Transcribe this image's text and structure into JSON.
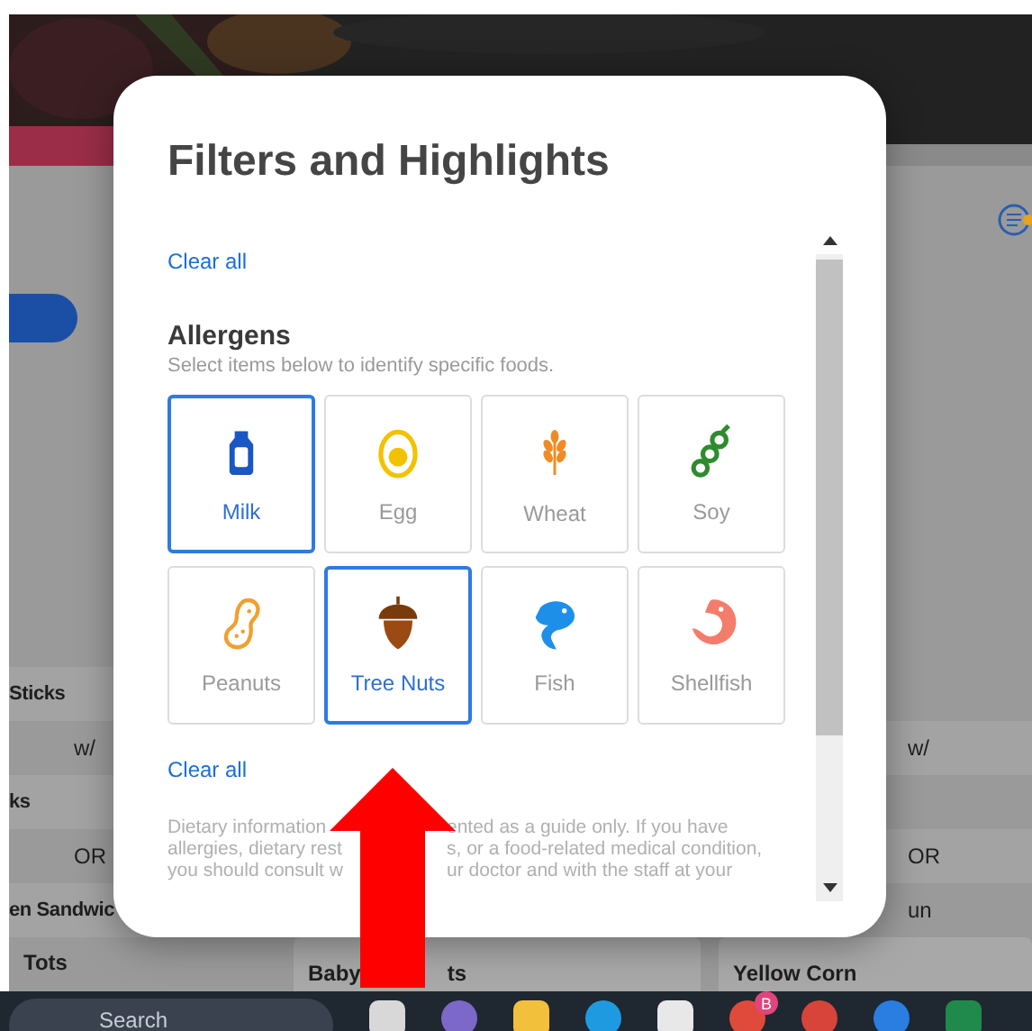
{
  "background_page": {
    "left_rows": [
      {
        "text": "Sticks",
        "kind": "name"
      },
      {
        "text": "w/",
        "kind": "joiner"
      },
      {
        "text": "ks",
        "kind": "name"
      },
      {
        "text": "OR",
        "kind": "joiner"
      },
      {
        "text": "en Sandwic",
        "kind": "name"
      }
    ],
    "right_rows": [
      {
        "text": "w/",
        "kind": "text"
      },
      {
        "kind": "blank"
      },
      {
        "text": "OR",
        "kind": "text"
      },
      {
        "text": "un",
        "kind": "text"
      }
    ],
    "bottom_cards": [
      {
        "parts": [
          "Tots"
        ]
      },
      {
        "parts": [
          "Baby",
          "ts"
        ]
      },
      {
        "parts": [
          "Yellow Corn"
        ]
      }
    ]
  },
  "modal": {
    "title": "Filters and Highlights",
    "clear_all_top": "Clear all",
    "allergens": {
      "title": "Allergens",
      "subtitle": "Select items below to identify specific foods.",
      "items": [
        {
          "label": "Milk",
          "kind": "milk",
          "selected": true
        },
        {
          "label": "Egg",
          "kind": "egg",
          "selected": false
        },
        {
          "label": "Wheat",
          "kind": "wheat",
          "selected": false
        },
        {
          "label": "Soy",
          "kind": "soy",
          "selected": false
        },
        {
          "label": "Peanuts",
          "kind": "peanut",
          "selected": false
        },
        {
          "label": "Tree Nuts",
          "kind": "acorn",
          "selected": true
        },
        {
          "label": "Fish",
          "kind": "fish",
          "selected": false
        },
        {
          "label": "Shellfish",
          "kind": "shrimp",
          "selected": false
        }
      ]
    },
    "clear_all_bottom": "Clear all",
    "disclaimer_lines": [
      [
        "Dietary information",
        "ented as a guide only. If you have"
      ],
      [
        "allergies, dietary rest",
        "s, or a food-related medical condition,"
      ],
      [
        "you should consult w",
        "ur doctor and with the staff at your"
      ]
    ]
  },
  "taskbar": {
    "search_placeholder": "Search",
    "badge": "B"
  }
}
